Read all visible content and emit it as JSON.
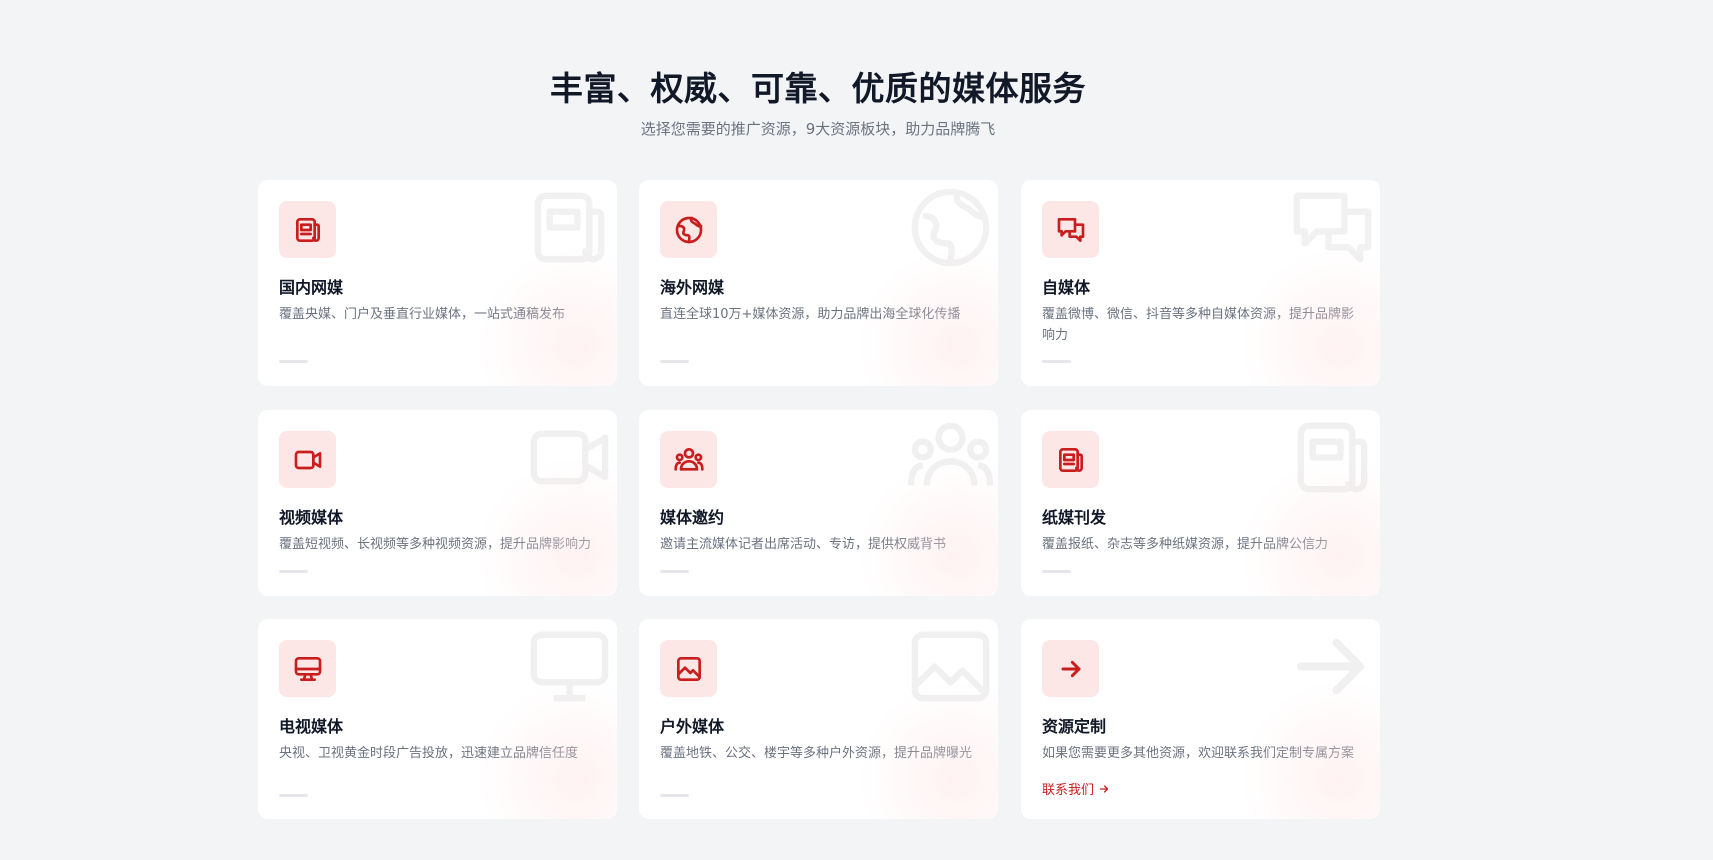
{
  "header": {
    "title": "丰富、权威、可靠、优质的媒体服务",
    "subtitle": "选择您需要的推广资源，9大资源板块，助力品牌腾飞"
  },
  "accent_color": "#c81e1e",
  "cards": [
    {
      "title": "国内网媒",
      "description": "覆盖央媒、门户及垂直行业媒体，一站式通稿发布",
      "icon": "newspaper-icon"
    },
    {
      "title": "海外网媒",
      "description": "直连全球10万+媒体资源，助力品牌出海全球化传播",
      "icon": "globe-icon"
    },
    {
      "title": "自媒体",
      "description": "覆盖微博、微信、抖音等多种自媒体资源，提升品牌影响力",
      "icon": "chat-bubbles-icon"
    },
    {
      "title": "视频媒体",
      "description": "覆盖短视频、长视频等多种视频资源，提升品牌影响力",
      "icon": "video-camera-icon"
    },
    {
      "title": "媒体邀约",
      "description": "邀请主流媒体记者出席活动、专访，提供权威背书",
      "icon": "user-group-icon"
    },
    {
      "title": "纸媒刊发",
      "description": "覆盖报纸、杂志等多种纸媒资源，提升品牌公信力",
      "icon": "newspaper-icon"
    },
    {
      "title": "电视媒体",
      "description": "央视、卫视黄金时段广告投放，迅速建立品牌信任度",
      "icon": "tv-monitor-icon"
    },
    {
      "title": "户外媒体",
      "description": "覆盖地铁、公交、楼宇等多种户外资源，提升品牌曝光",
      "icon": "image-icon"
    },
    {
      "title": "资源定制",
      "description": "如果您需要更多其他资源，欢迎联系我们定制专属方案",
      "icon": "arrow-right-icon",
      "link_label": "联系我们"
    }
  ]
}
